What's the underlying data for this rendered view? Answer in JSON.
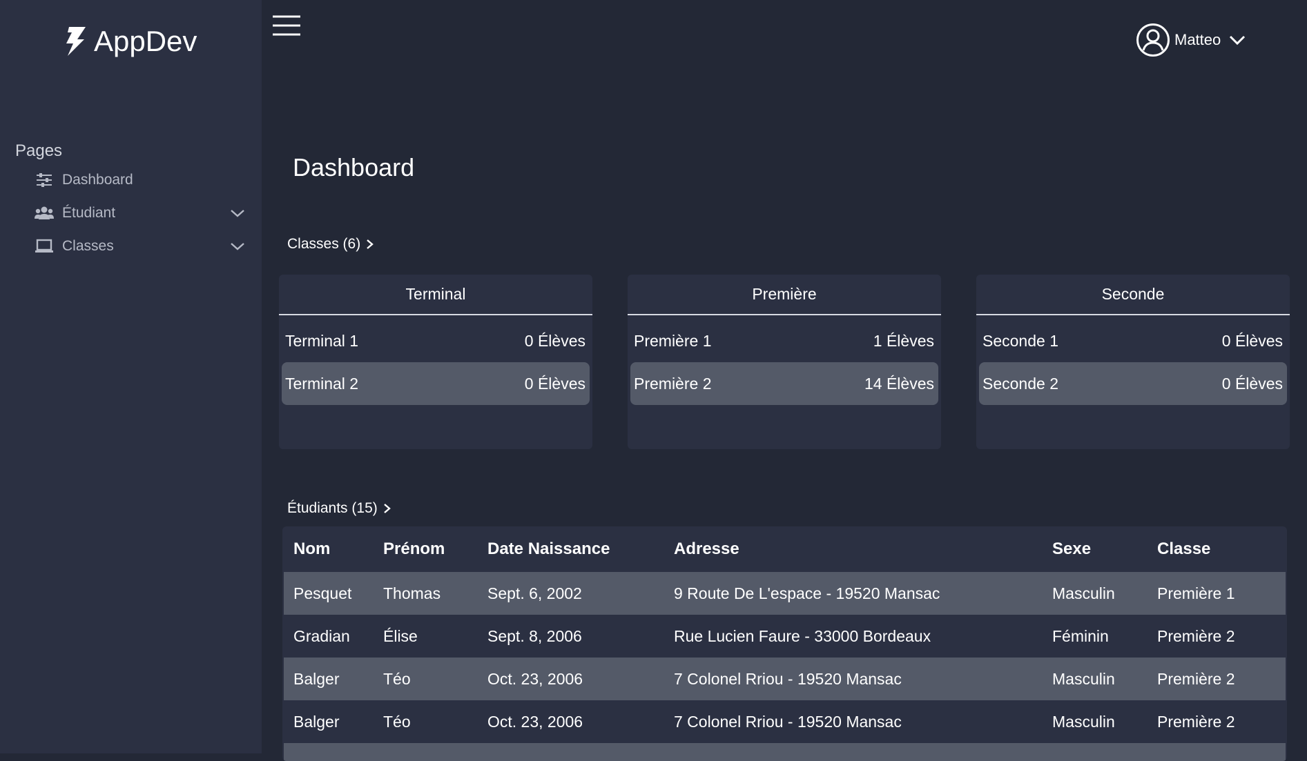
{
  "brand": {
    "name": "AppDev"
  },
  "sidebar": {
    "section_label": "Pages",
    "items": [
      {
        "label": "Dashboard",
        "icon": "sliders-icon",
        "has_children": false
      },
      {
        "label": "Étudiant",
        "icon": "users-icon",
        "has_children": true
      },
      {
        "label": "Classes",
        "icon": "laptop-icon",
        "has_children": true
      }
    ]
  },
  "header": {
    "menu_icon": "hamburger-icon",
    "user": {
      "name": "Matteo",
      "icon": "user-circle-icon"
    }
  },
  "main": {
    "title": "Dashboard",
    "classes_link": "Classes (6)",
    "cards": [
      {
        "title": "Terminal",
        "rows": [
          {
            "name": "Terminal 1",
            "count": "0 Élèves"
          },
          {
            "name": "Terminal 2",
            "count": "0 Élèves"
          }
        ]
      },
      {
        "title": "Première",
        "rows": [
          {
            "name": "Première 1",
            "count": "1 Élèves"
          },
          {
            "name": "Première 2",
            "count": "14 Élèves"
          }
        ]
      },
      {
        "title": "Seconde",
        "rows": [
          {
            "name": "Seconde 1",
            "count": "0 Élèves"
          },
          {
            "name": "Seconde 2",
            "count": "0 Élèves"
          }
        ]
      }
    ],
    "students_link": "Étudiants (15)",
    "table": {
      "columns": [
        "Nom",
        "Prénom",
        "Date Naissance",
        "Adresse",
        "Sexe",
        "Classe"
      ],
      "rows": [
        [
          "Pesquet",
          "Thomas",
          "Sept. 6, 2002",
          "9 Route De L'espace - 19520 Mansac",
          "Masculin",
          "Première 1"
        ],
        [
          "Gradian",
          "Élise",
          "Sept. 8, 2006",
          "Rue Lucien Faure - 33000 Bordeaux",
          "Féminin",
          "Première 2"
        ],
        [
          "Balger",
          "Téo",
          "Oct. 23, 2006",
          "7 Colonel Rriou - 19520 Mansac",
          "Masculin",
          "Première 2"
        ],
        [
          "Balger",
          "Téo",
          "Oct. 23, 2006",
          "7 Colonel Rriou - 19520 Mansac",
          "Masculin",
          "Première 2"
        ]
      ]
    }
  },
  "colors": {
    "background": "#232836",
    "sidebar": "#2b3042",
    "card": "#2b3042",
    "row_alt": "#545a68",
    "text": "#ffffff",
    "muted_text": "#b6bac6"
  }
}
